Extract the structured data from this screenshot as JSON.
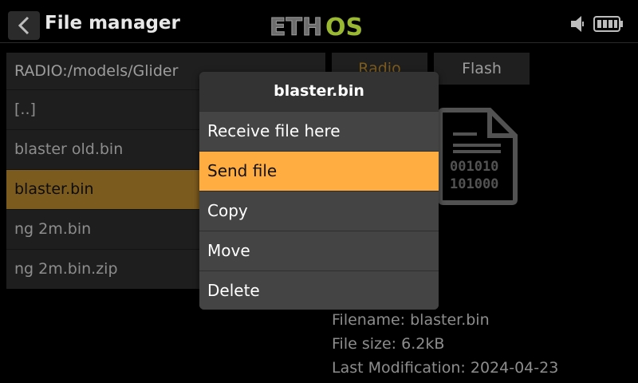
{
  "header": {
    "title": "File manager",
    "logo_text": "ETHOS",
    "icons": [
      "back-arrow-icon",
      "speaker-icon",
      "battery-icon"
    ]
  },
  "file_list": {
    "path": "RADIO:/models/Glider",
    "items": [
      {
        "label": "[..]",
        "selected": false
      },
      {
        "label": "blaster old.bin",
        "selected": false
      },
      {
        "label": "blaster.bin",
        "selected": true
      },
      {
        "label": "ng 2m.bin",
        "selected": false
      },
      {
        "label": "ng 2m.bin.zip",
        "selected": false
      }
    ]
  },
  "tabs": {
    "radio": "Radio",
    "flash": "Flash"
  },
  "details": {
    "filename": "Filename: blaster.bin",
    "file_size": "File size: 6.2kB",
    "last_modification": "Last Modification: 2024-04-23"
  },
  "context_menu": {
    "title": "blaster.bin",
    "items": [
      "Receive file here",
      "Send file",
      "Copy",
      "Move",
      "Delete"
    ],
    "active_item": "Send file"
  },
  "colors": {
    "accent": "#ffad40",
    "selected_row": "#a67a28",
    "logo_green": "#9ab832"
  }
}
